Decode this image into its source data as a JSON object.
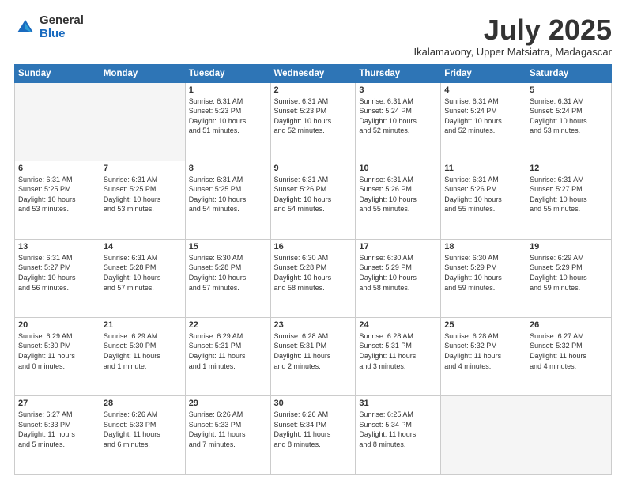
{
  "logo": {
    "general": "General",
    "blue": "Blue"
  },
  "header": {
    "month": "July 2025",
    "location": "Ikalamavony, Upper Matsiatra, Madagascar"
  },
  "weekdays": [
    "Sunday",
    "Monday",
    "Tuesday",
    "Wednesday",
    "Thursday",
    "Friday",
    "Saturday"
  ],
  "weeks": [
    [
      {
        "day": "",
        "info": ""
      },
      {
        "day": "",
        "info": ""
      },
      {
        "day": "1",
        "info": "Sunrise: 6:31 AM\nSunset: 5:23 PM\nDaylight: 10 hours\nand 51 minutes."
      },
      {
        "day": "2",
        "info": "Sunrise: 6:31 AM\nSunset: 5:23 PM\nDaylight: 10 hours\nand 52 minutes."
      },
      {
        "day": "3",
        "info": "Sunrise: 6:31 AM\nSunset: 5:24 PM\nDaylight: 10 hours\nand 52 minutes."
      },
      {
        "day": "4",
        "info": "Sunrise: 6:31 AM\nSunset: 5:24 PM\nDaylight: 10 hours\nand 52 minutes."
      },
      {
        "day": "5",
        "info": "Sunrise: 6:31 AM\nSunset: 5:24 PM\nDaylight: 10 hours\nand 53 minutes."
      }
    ],
    [
      {
        "day": "6",
        "info": "Sunrise: 6:31 AM\nSunset: 5:25 PM\nDaylight: 10 hours\nand 53 minutes."
      },
      {
        "day": "7",
        "info": "Sunrise: 6:31 AM\nSunset: 5:25 PM\nDaylight: 10 hours\nand 53 minutes."
      },
      {
        "day": "8",
        "info": "Sunrise: 6:31 AM\nSunset: 5:25 PM\nDaylight: 10 hours\nand 54 minutes."
      },
      {
        "day": "9",
        "info": "Sunrise: 6:31 AM\nSunset: 5:26 PM\nDaylight: 10 hours\nand 54 minutes."
      },
      {
        "day": "10",
        "info": "Sunrise: 6:31 AM\nSunset: 5:26 PM\nDaylight: 10 hours\nand 55 minutes."
      },
      {
        "day": "11",
        "info": "Sunrise: 6:31 AM\nSunset: 5:26 PM\nDaylight: 10 hours\nand 55 minutes."
      },
      {
        "day": "12",
        "info": "Sunrise: 6:31 AM\nSunset: 5:27 PM\nDaylight: 10 hours\nand 55 minutes."
      }
    ],
    [
      {
        "day": "13",
        "info": "Sunrise: 6:31 AM\nSunset: 5:27 PM\nDaylight: 10 hours\nand 56 minutes."
      },
      {
        "day": "14",
        "info": "Sunrise: 6:31 AM\nSunset: 5:28 PM\nDaylight: 10 hours\nand 57 minutes."
      },
      {
        "day": "15",
        "info": "Sunrise: 6:30 AM\nSunset: 5:28 PM\nDaylight: 10 hours\nand 57 minutes."
      },
      {
        "day": "16",
        "info": "Sunrise: 6:30 AM\nSunset: 5:28 PM\nDaylight: 10 hours\nand 58 minutes."
      },
      {
        "day": "17",
        "info": "Sunrise: 6:30 AM\nSunset: 5:29 PM\nDaylight: 10 hours\nand 58 minutes."
      },
      {
        "day": "18",
        "info": "Sunrise: 6:30 AM\nSunset: 5:29 PM\nDaylight: 10 hours\nand 59 minutes."
      },
      {
        "day": "19",
        "info": "Sunrise: 6:29 AM\nSunset: 5:29 PM\nDaylight: 10 hours\nand 59 minutes."
      }
    ],
    [
      {
        "day": "20",
        "info": "Sunrise: 6:29 AM\nSunset: 5:30 PM\nDaylight: 11 hours\nand 0 minutes."
      },
      {
        "day": "21",
        "info": "Sunrise: 6:29 AM\nSunset: 5:30 PM\nDaylight: 11 hours\nand 1 minute."
      },
      {
        "day": "22",
        "info": "Sunrise: 6:29 AM\nSunset: 5:31 PM\nDaylight: 11 hours\nand 1 minutes."
      },
      {
        "day": "23",
        "info": "Sunrise: 6:28 AM\nSunset: 5:31 PM\nDaylight: 11 hours\nand 2 minutes."
      },
      {
        "day": "24",
        "info": "Sunrise: 6:28 AM\nSunset: 5:31 PM\nDaylight: 11 hours\nand 3 minutes."
      },
      {
        "day": "25",
        "info": "Sunrise: 6:28 AM\nSunset: 5:32 PM\nDaylight: 11 hours\nand 4 minutes."
      },
      {
        "day": "26",
        "info": "Sunrise: 6:27 AM\nSunset: 5:32 PM\nDaylight: 11 hours\nand 4 minutes."
      }
    ],
    [
      {
        "day": "27",
        "info": "Sunrise: 6:27 AM\nSunset: 5:33 PM\nDaylight: 11 hours\nand 5 minutes."
      },
      {
        "day": "28",
        "info": "Sunrise: 6:26 AM\nSunset: 5:33 PM\nDaylight: 11 hours\nand 6 minutes."
      },
      {
        "day": "29",
        "info": "Sunrise: 6:26 AM\nSunset: 5:33 PM\nDaylight: 11 hours\nand 7 minutes."
      },
      {
        "day": "30",
        "info": "Sunrise: 6:26 AM\nSunset: 5:34 PM\nDaylight: 11 hours\nand 8 minutes."
      },
      {
        "day": "31",
        "info": "Sunrise: 6:25 AM\nSunset: 5:34 PM\nDaylight: 11 hours\nand 8 minutes."
      },
      {
        "day": "",
        "info": ""
      },
      {
        "day": "",
        "info": ""
      }
    ]
  ]
}
